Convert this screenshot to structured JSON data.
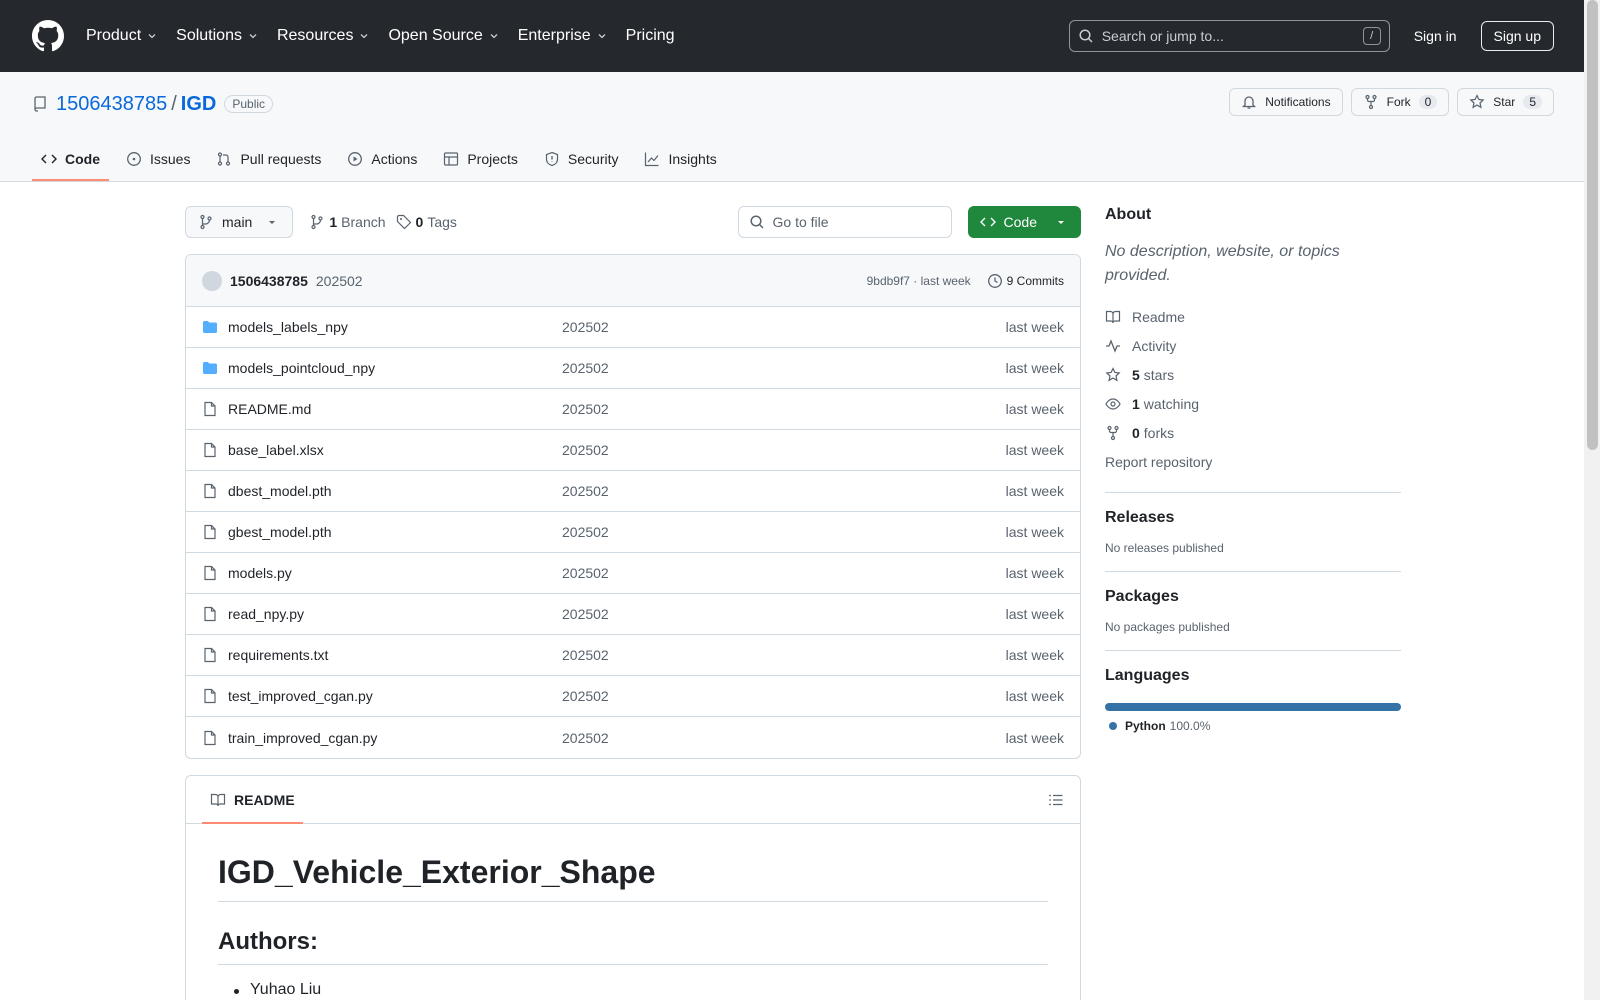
{
  "nav": {
    "items": [
      "Product",
      "Solutions",
      "Resources",
      "Open Source",
      "Enterprise",
      "Pricing"
    ],
    "search_placeholder": "Search or jump to...",
    "search_key": "/",
    "signin": "Sign in",
    "signup": "Sign up"
  },
  "repo": {
    "owner": "1506438785",
    "sep": "/",
    "name": "IGD",
    "visibility": "Public",
    "notifications": "Notifications",
    "fork_label": "Fork",
    "fork_count": "0",
    "star_label": "Star",
    "star_count": "5"
  },
  "tabs": [
    "Code",
    "Issues",
    "Pull requests",
    "Actions",
    "Projects",
    "Security",
    "Insights"
  ],
  "toolbar": {
    "branch": "main",
    "branch_count": "1",
    "branch_label": "Branch",
    "tag_count": "0",
    "tag_label": "Tags",
    "goto_placeholder": "Go to file",
    "code_label": "Code"
  },
  "commit": {
    "user": "1506438785",
    "message": "202502",
    "sha_time": "9bdb9f7 · last week",
    "commits": "9 Commits"
  },
  "files": [
    {
      "name": "models_labels_npy",
      "type": "folder",
      "msg": "202502",
      "age": "last week"
    },
    {
      "name": "models_pointcloud_npy",
      "type": "folder",
      "msg": "202502",
      "age": "last week"
    },
    {
      "name": "README.md",
      "type": "file",
      "msg": "202502",
      "age": "last week"
    },
    {
      "name": "base_label.xlsx",
      "type": "file",
      "msg": "202502",
      "age": "last week"
    },
    {
      "name": "dbest_model.pth",
      "type": "file",
      "msg": "202502",
      "age": "last week"
    },
    {
      "name": "gbest_model.pth",
      "type": "file",
      "msg": "202502",
      "age": "last week"
    },
    {
      "name": "models.py",
      "type": "file",
      "msg": "202502",
      "age": "last week"
    },
    {
      "name": "read_npy.py",
      "type": "file",
      "msg": "202502",
      "age": "last week"
    },
    {
      "name": "requirements.txt",
      "type": "file",
      "msg": "202502",
      "age": "last week"
    },
    {
      "name": "test_improved_cgan.py",
      "type": "file",
      "msg": "202502",
      "age": "last week"
    },
    {
      "name": "train_improved_cgan.py",
      "type": "file",
      "msg": "202502",
      "age": "last week"
    }
  ],
  "readme": {
    "tab": "README",
    "h1": "IGD_Vehicle_Exterior_Shape",
    "h2": "Authors:",
    "author1": "Yuhao Liu"
  },
  "about": {
    "title": "About",
    "desc": "No description, website, or topics provided.",
    "readme": "Readme",
    "activity": "Activity",
    "stars_n": "5",
    "stars": "stars",
    "watching_n": "1",
    "watching": "watching",
    "forks_n": "0",
    "forks": "forks",
    "report": "Report repository"
  },
  "releases": {
    "title": "Releases",
    "text": "No releases published"
  },
  "packages": {
    "title": "Packages",
    "text": "No packages published"
  },
  "languages": {
    "title": "Languages",
    "name": "Python",
    "pct": "100.0%",
    "color": "#3572A5"
  }
}
